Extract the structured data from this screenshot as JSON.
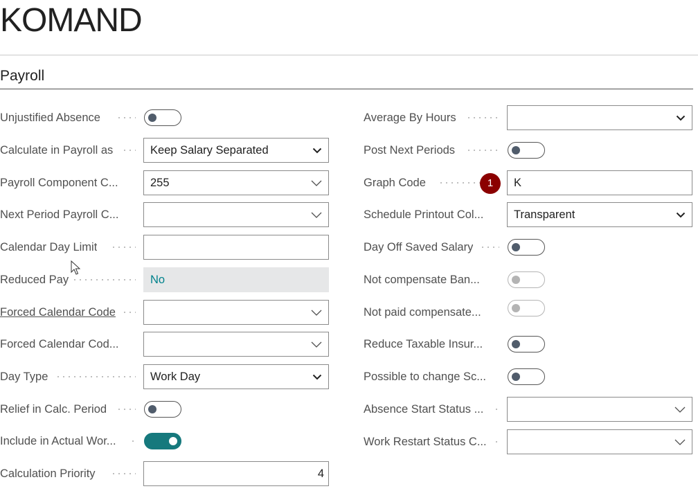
{
  "page": {
    "title": "KOMAND"
  },
  "section": {
    "title": "Payroll"
  },
  "left_fields": [
    {
      "label": "Unjustified Absence",
      "type": "toggle",
      "state": "off"
    },
    {
      "label": "Calculate in Payroll as",
      "type": "select",
      "value": "Keep Salary Separated"
    },
    {
      "label": "Payroll Component C...",
      "type": "lookup",
      "value": "255"
    },
    {
      "label": "Next Period Payroll C...",
      "type": "lookup",
      "value": ""
    },
    {
      "label": "Calendar Day Limit",
      "type": "text",
      "value": ""
    },
    {
      "label": "Reduced Pay",
      "type": "readonly",
      "value": "No"
    },
    {
      "label": "Forced Calendar Code",
      "type": "lookup",
      "value": "",
      "link": true
    },
    {
      "label": "Forced Calendar Cod...",
      "type": "lookup",
      "value": ""
    },
    {
      "label": "Day Type",
      "type": "select",
      "value": "Work Day"
    },
    {
      "label": "Relief in Calc. Period",
      "type": "toggle",
      "state": "off"
    },
    {
      "label": "Include in Actual Wor...",
      "type": "toggle",
      "state": "on"
    },
    {
      "label": "Calculation Priority",
      "type": "number",
      "value": "4"
    }
  ],
  "right_fields": [
    {
      "label": "Average By Hours",
      "type": "select",
      "value": ""
    },
    {
      "label": "Post Next Periods",
      "type": "toggle",
      "state": "off"
    },
    {
      "label": "Graph Code",
      "type": "text",
      "value": "K",
      "badge": "1"
    },
    {
      "label": "Schedule Printout Col...",
      "type": "select",
      "value": "Transparent"
    },
    {
      "label": "Day Off Saved Salary",
      "type": "toggle",
      "state": "off"
    },
    {
      "label": "Not compensate Ban...",
      "type": "toggle",
      "state": "disabled"
    },
    {
      "label": "Not paid compensate...",
      "type": "toggle",
      "state": "disabled"
    },
    {
      "label": "Reduce Taxable Insur...",
      "type": "toggle",
      "state": "off"
    },
    {
      "label": "Possible to change Sc...",
      "type": "toggle",
      "state": "off"
    },
    {
      "label": "Absence Start Status ...",
      "type": "lookup",
      "value": ""
    },
    {
      "label": "Work Restart Status C...",
      "type": "lookup",
      "value": ""
    }
  ],
  "colors": {
    "accent": "#16797d",
    "badge": "#8b0000",
    "readonly_text": "#00828c"
  }
}
